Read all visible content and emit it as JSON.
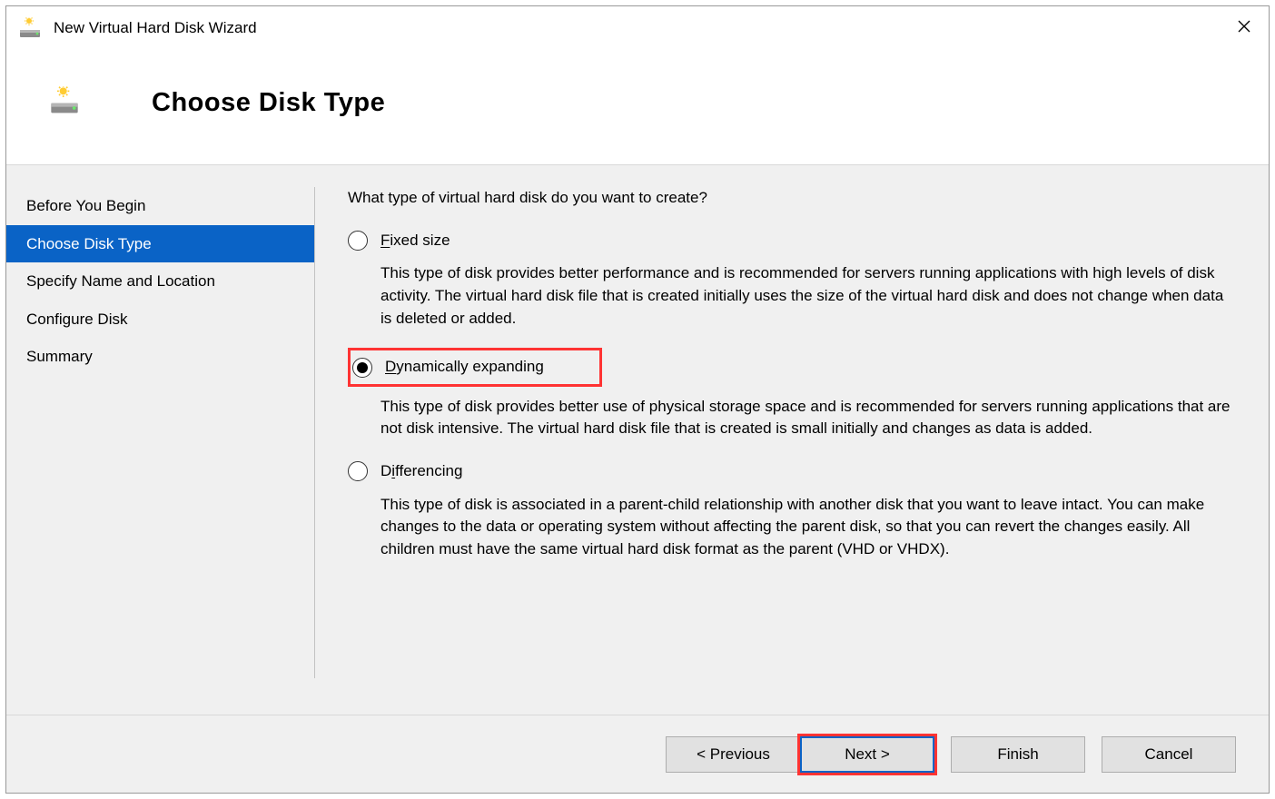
{
  "window": {
    "title": "New Virtual Hard Disk Wizard"
  },
  "header": {
    "page_title": "Choose Disk Type"
  },
  "sidebar": {
    "steps": [
      {
        "label": "Before You Begin",
        "selected": false
      },
      {
        "label": "Choose Disk Type",
        "selected": true
      },
      {
        "label": "Specify Name and Location",
        "selected": false
      },
      {
        "label": "Configure Disk",
        "selected": false
      },
      {
        "label": "Summary",
        "selected": false
      }
    ]
  },
  "content": {
    "question": "What type of virtual hard disk do you want to create?",
    "options": [
      {
        "id": "fixed",
        "label_pre": "",
        "hotkey": "F",
        "label_post": "ixed size",
        "checked": false,
        "highlight": false,
        "description": "This type of disk provides better performance and is recommended for servers running applications with high levels of disk activity. The virtual hard disk file that is created initially uses the size of the virtual hard disk and does not change when data is deleted or added."
      },
      {
        "id": "dynamic",
        "label_pre": "",
        "hotkey": "D",
        "label_post": "ynamically expanding",
        "checked": true,
        "highlight": true,
        "description": "This type of disk provides better use of physical storage space and is recommended for servers running applications that are not disk intensive. The virtual hard disk file that is created is small initially and changes as data is added."
      },
      {
        "id": "differencing",
        "label_pre": "D",
        "hotkey": "i",
        "label_post": "fferencing",
        "checked": false,
        "highlight": false,
        "description": "This type of disk is associated in a parent-child relationship with another disk that you want to leave intact. You can make changes to the data or operating system without affecting the parent disk, so that you can revert the changes easily. All children must have the same virtual hard disk format as the parent (VHD or VHDX)."
      }
    ]
  },
  "footer": {
    "previous": "< Previous",
    "next": "Next >",
    "finish": "Finish",
    "cancel": "Cancel"
  }
}
